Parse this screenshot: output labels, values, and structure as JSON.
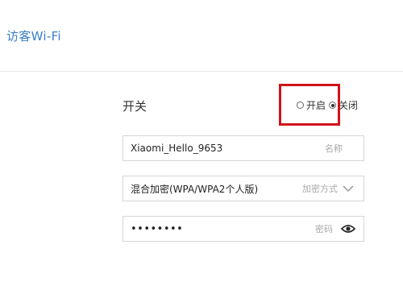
{
  "header": {
    "title": "访客Wi-Fi"
  },
  "switch": {
    "label": "开关",
    "options": [
      {
        "label": "开启",
        "checked": false
      },
      {
        "label": "关闭",
        "checked": true
      }
    ]
  },
  "form": {
    "ssid": {
      "value": "Xiaomi_Hello_9653",
      "hint": "名称"
    },
    "encryption": {
      "value": "混合加密(WPA/WPA2个人版)",
      "hint": "加密方式"
    },
    "password": {
      "value": "••••••••",
      "hint": "密码"
    }
  },
  "colors": {
    "title": "#3b7fc4",
    "highlight": "#d0141c",
    "field_border": "#d6d6d6",
    "hint": "#a8a8a8"
  },
  "icons": {
    "encryption_dropdown": "chevron-down-icon",
    "password_toggle": "eye-icon"
  }
}
